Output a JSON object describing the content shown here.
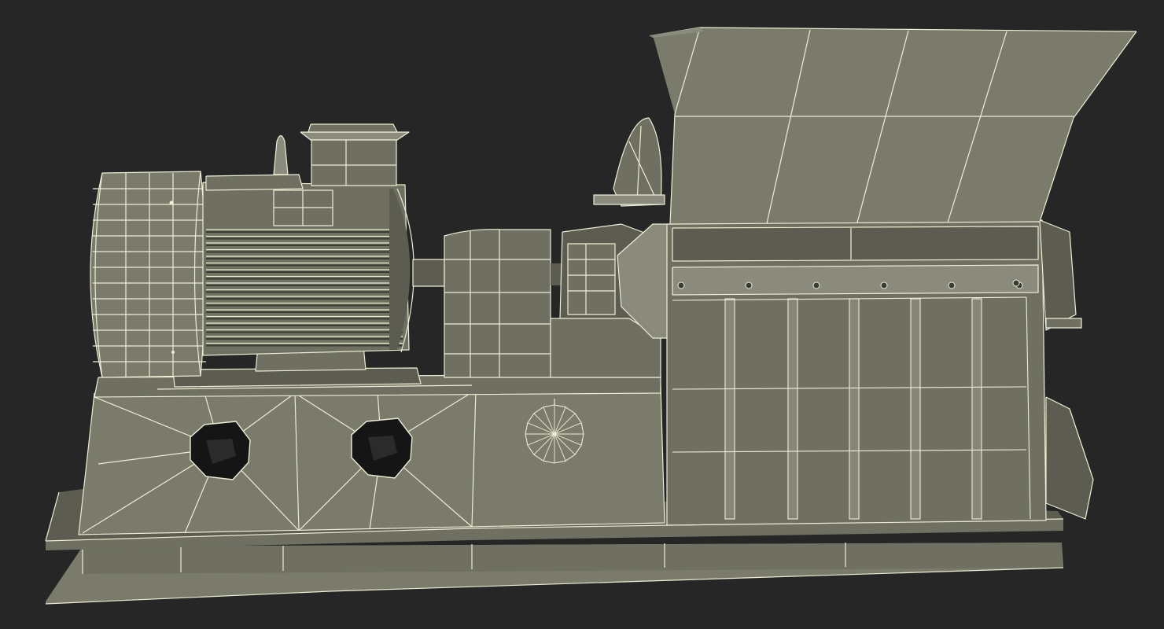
{
  "scene": {
    "subject": "hammer-mill-wireframe-render",
    "colors": {
      "background": "#262626",
      "body": "#777868",
      "body_light": "#8a8b7c",
      "body_dark": "#5e5f52",
      "wire": "#eeeed6",
      "hole": "#151515"
    }
  }
}
